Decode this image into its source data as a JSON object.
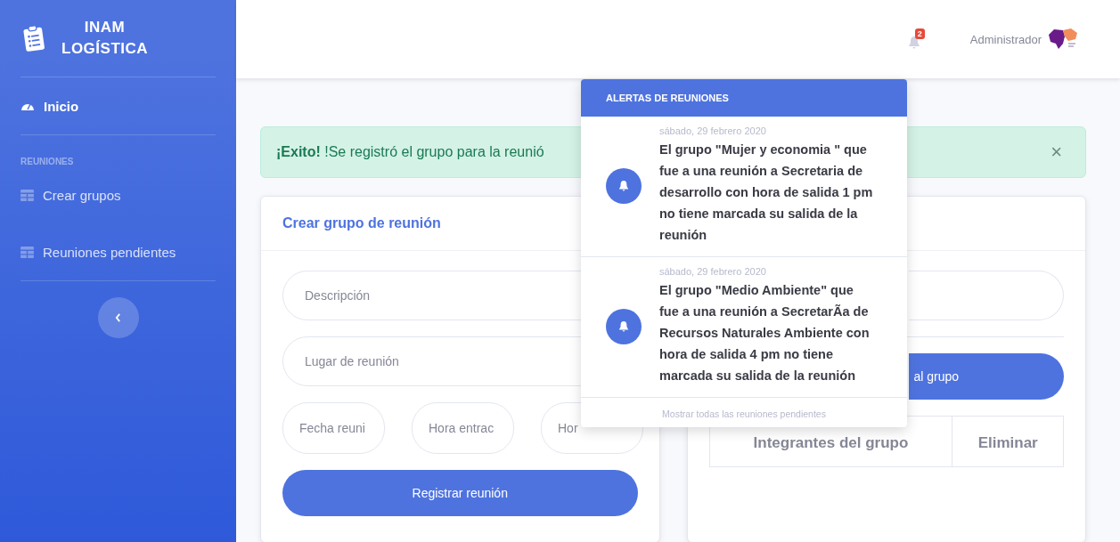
{
  "sidebar": {
    "brand": {
      "line1": "INAM",
      "line2": "LOGÍSTICA"
    },
    "items": [
      {
        "kind": "link",
        "label": "Inicio",
        "selected": true
      },
      {
        "kind": "heading",
        "label": "REUNIONES"
      },
      {
        "kind": "link",
        "label": "Crear grupos",
        "selected": false
      },
      {
        "kind": "link",
        "label": "Reuniones pendientes",
        "selected": false
      }
    ]
  },
  "topbar": {
    "notification_count": "2",
    "user": "Administrador"
  },
  "alert": {
    "message": "**¡Exito!** !Se registró el grupo para la reunió",
    "close": "×"
  },
  "left_card": {
    "title": "Crear grupo de reunión",
    "fields": [
      {
        "placeholder": "Descripción"
      },
      {
        "placeholder": "Lugar de reunión"
      }
    ],
    "small_fields": [
      {
        "placeholder": "Fecha reuni"
      },
      {
        "placeholder": "Hora entrac"
      },
      {
        "placeholder": "Hor"
      }
    ],
    "button": "Registrar reunión"
  },
  "right_card": {
    "button": "al grupo",
    "table": {
      "columns": [
        "Integrantes del grupo",
        "Eliminar"
      ]
    }
  },
  "dropdown": {
    "header": "ALERTAS DE REUNIONES",
    "items": [
      {
        "date": "sábado, 29 febrero 2020",
        "message": "El grupo \"Mujer y economia \" que fue a una reunión a Secretaria de desarrollo con hora de salida 1 pm no tiene marcada su salida de la reunión"
      },
      {
        "date": "sábado, 29 febrero 2020",
        "message": "El grupo \"Medio Ambiente\" que fue a una reunión a SecretarÃa de Recursos Naturales Ambiente con hora de salida 4 pm no tiene marcada su salida de la reunión"
      }
    ],
    "footer": "Mostrar todas las reuniones pendientes"
  }
}
